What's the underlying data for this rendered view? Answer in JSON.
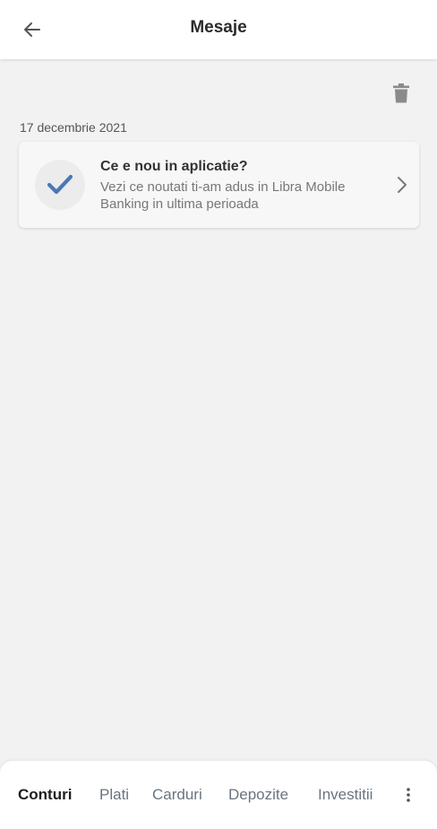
{
  "header": {
    "title": "Mesaje",
    "back_icon": "arrow-left-icon"
  },
  "toolbar": {
    "trash_icon": "trash-icon"
  },
  "messages": {
    "date": "17 decembrie 2021",
    "items": [
      {
        "title": "Ce e nou in aplicatie?",
        "body": "Vezi ce noutati ti-am adus in Libra Mobile Banking in ultima perioada",
        "icon": "checkmark-icon"
      }
    ]
  },
  "bottom_nav": {
    "items": [
      {
        "label": "Conturi",
        "active": true
      },
      {
        "label": "Plati",
        "active": false
      },
      {
        "label": "Carduri",
        "active": false
      },
      {
        "label": "Depozite",
        "active": false
      },
      {
        "label": "Investitii",
        "active": false
      }
    ],
    "more_icon": "more-vertical-icon"
  },
  "colors": {
    "accent": "#4a78b5",
    "background": "#f2f2f2",
    "card": "#f7f7f7",
    "text_primary": "#2b2b2b",
    "text_secondary": "#777777"
  }
}
